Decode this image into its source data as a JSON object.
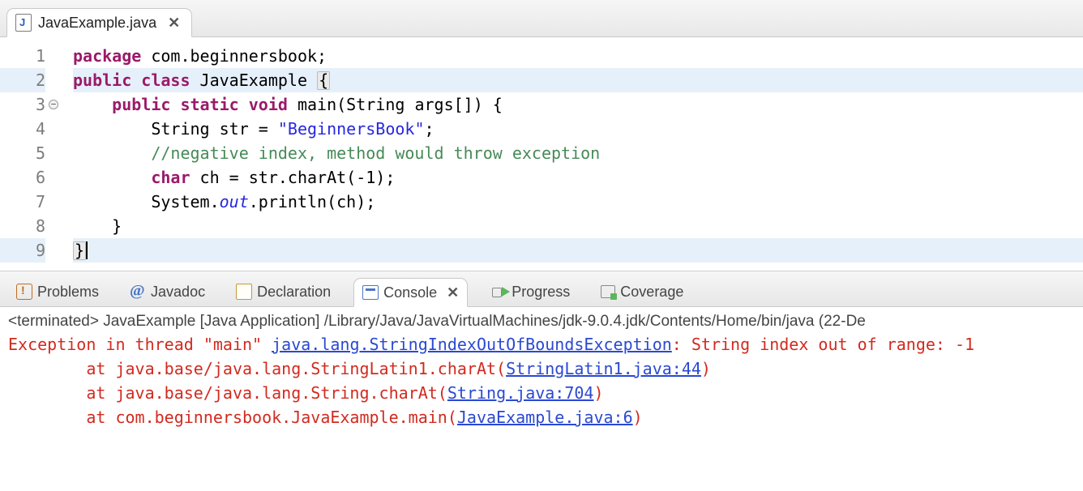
{
  "editor": {
    "tab_filename": "JavaExample.java",
    "lines": [
      {
        "n": 1,
        "hl": false,
        "fold": false,
        "tokens": [
          {
            "cls": "kw",
            "t": "package"
          },
          {
            "cls": "",
            "t": " com.beginnersbook;"
          }
        ]
      },
      {
        "n": 2,
        "hl": true,
        "fold": false,
        "tokens": [
          {
            "cls": "kw",
            "t": "public"
          },
          {
            "cls": "",
            "t": " "
          },
          {
            "cls": "kw",
            "t": "class"
          },
          {
            "cls": "",
            "t": " JavaExample "
          },
          {
            "cls": "brace-hl",
            "t": "{"
          }
        ]
      },
      {
        "n": 3,
        "hl": false,
        "fold": true,
        "tokens": [
          {
            "cls": "",
            "t": "    "
          },
          {
            "cls": "kw",
            "t": "public"
          },
          {
            "cls": "",
            "t": " "
          },
          {
            "cls": "kw",
            "t": "static"
          },
          {
            "cls": "",
            "t": " "
          },
          {
            "cls": "kw",
            "t": "void"
          },
          {
            "cls": "",
            "t": " main(String args[]) {"
          }
        ]
      },
      {
        "n": 4,
        "hl": false,
        "fold": false,
        "tokens": [
          {
            "cls": "",
            "t": "        String str = "
          },
          {
            "cls": "str",
            "t": "\"BeginnersBook\""
          },
          {
            "cls": "",
            "t": ";"
          }
        ]
      },
      {
        "n": 5,
        "hl": false,
        "fold": false,
        "tokens": [
          {
            "cls": "",
            "t": "        "
          },
          {
            "cls": "com",
            "t": "//negative index, method would throw exception"
          }
        ]
      },
      {
        "n": 6,
        "hl": false,
        "fold": false,
        "tokens": [
          {
            "cls": "",
            "t": "        "
          },
          {
            "cls": "kw",
            "t": "char"
          },
          {
            "cls": "",
            "t": " ch = str.charAt(-1);"
          }
        ]
      },
      {
        "n": 7,
        "hl": false,
        "fold": false,
        "tokens": [
          {
            "cls": "",
            "t": "        System."
          },
          {
            "cls": "fld",
            "t": "out"
          },
          {
            "cls": "",
            "t": ".println(ch);"
          }
        ]
      },
      {
        "n": 8,
        "hl": false,
        "fold": false,
        "tokens": [
          {
            "cls": "",
            "t": "    }"
          }
        ]
      },
      {
        "n": 9,
        "hl": true,
        "fold": false,
        "caret": true,
        "tokens": [
          {
            "cls": "brace-hl",
            "t": "}"
          }
        ]
      }
    ]
  },
  "views": {
    "items": [
      {
        "id": "problems",
        "label": "Problems",
        "active": false
      },
      {
        "id": "javadoc",
        "label": "Javadoc",
        "active": false
      },
      {
        "id": "decl",
        "label": "Declaration",
        "active": false
      },
      {
        "id": "console",
        "label": "Console",
        "active": true
      },
      {
        "id": "progress",
        "label": "Progress",
        "active": false
      },
      {
        "id": "coverage",
        "label": "Coverage",
        "active": false
      }
    ]
  },
  "console": {
    "term_label": "<terminated> JavaExample [Java Application] /Library/Java/JavaVirtualMachines/jdk-9.0.4.jdk/Contents/Home/bin/java (22-De",
    "out": [
      {
        "segs": [
          {
            "cls": "err",
            "t": "Exception in thread \"main\" "
          },
          {
            "cls": "lnk",
            "t": "java.lang.StringIndexOutOfBoundsException"
          },
          {
            "cls": "err",
            "t": ": String index out of range: -1"
          }
        ]
      },
      {
        "segs": [
          {
            "cls": "err",
            "t": "\tat java.base/java.lang.StringLatin1.charAt("
          },
          {
            "cls": "lnk",
            "t": "StringLatin1.java:44"
          },
          {
            "cls": "err",
            "t": ")"
          }
        ]
      },
      {
        "segs": [
          {
            "cls": "err",
            "t": "\tat java.base/java.lang.String.charAt("
          },
          {
            "cls": "lnk",
            "t": "String.java:704"
          },
          {
            "cls": "err",
            "t": ")"
          }
        ]
      },
      {
        "segs": [
          {
            "cls": "err",
            "t": "\tat com.beginnersbook.JavaExample.main("
          },
          {
            "cls": "lnk",
            "t": "JavaExample.java:6"
          },
          {
            "cls": "err",
            "t": ")"
          }
        ]
      }
    ]
  }
}
